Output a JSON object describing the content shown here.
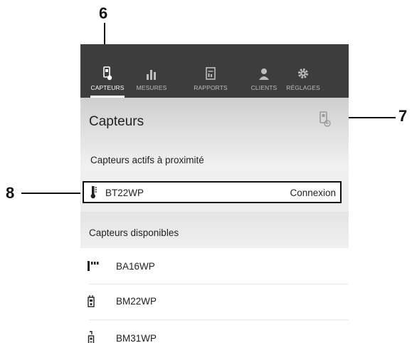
{
  "callouts": {
    "c6": "6",
    "c7": "7",
    "c8": "8"
  },
  "nav": {
    "tabs": [
      {
        "label": "CAPTEURS",
        "icon": "sensor-icon",
        "active": true
      },
      {
        "label": "MESURES",
        "icon": "bar-chart-icon",
        "active": false
      },
      {
        "label": "RAPPORTS",
        "icon": "report-icon",
        "active": false
      },
      {
        "label": "CLIENTS",
        "icon": "clients-icon",
        "active": false
      },
      {
        "label": "RÉGLAGES",
        "icon": "gear-icon",
        "active": false
      }
    ]
  },
  "header": {
    "title": "Capteurs",
    "scan_icon": "sensor-scan-icon"
  },
  "nearby": {
    "heading": "Capteurs actifs à proximité",
    "items": [
      {
        "name": "BT22WP",
        "action": "Connexion",
        "icon": "thermometer-probe-icon"
      }
    ]
  },
  "available": {
    "heading": "Capteurs disponibles",
    "items": [
      {
        "name": "BA16WP",
        "icon": "signal-bars-icon"
      },
      {
        "name": "BM22WP",
        "icon": "multimeter-icon"
      },
      {
        "name": "BM31WP",
        "icon": "clamp-meter-icon"
      }
    ]
  },
  "colors": {
    "topbar": "#3d3d3d",
    "tab_inactive": "#bdbdbd",
    "tab_active": "#ffffff"
  }
}
